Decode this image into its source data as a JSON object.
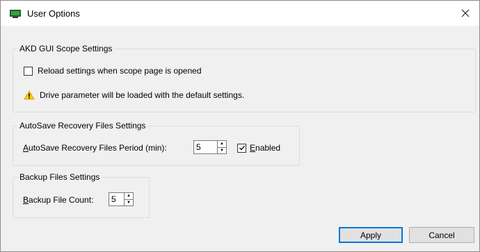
{
  "window": {
    "title": "User Options"
  },
  "akd": {
    "title": "AKD GUI Scope Settings",
    "reload_label": "Reload settings when scope page is opened",
    "reload_checked": false,
    "warning_text": "Drive parameter will be loaded with the default settings."
  },
  "autosave": {
    "title": "AutoSave Recovery Files Settings",
    "period_label_mnemonic": "A",
    "period_label_rest": "utoSave Recovery Files Period (min):",
    "period_value": "5",
    "enabled_mnemonic": "E",
    "enabled_rest": "nabled",
    "enabled_checked": true
  },
  "backup": {
    "title": "Backup Files Settings",
    "count_label_mnemonic": "B",
    "count_label_rest": "ackup File Count:",
    "count_value": "5"
  },
  "buttons": {
    "apply": "Apply",
    "cancel": "Cancel"
  },
  "colors": {
    "accent": "#0078d7",
    "warning": "#ffcc00"
  }
}
